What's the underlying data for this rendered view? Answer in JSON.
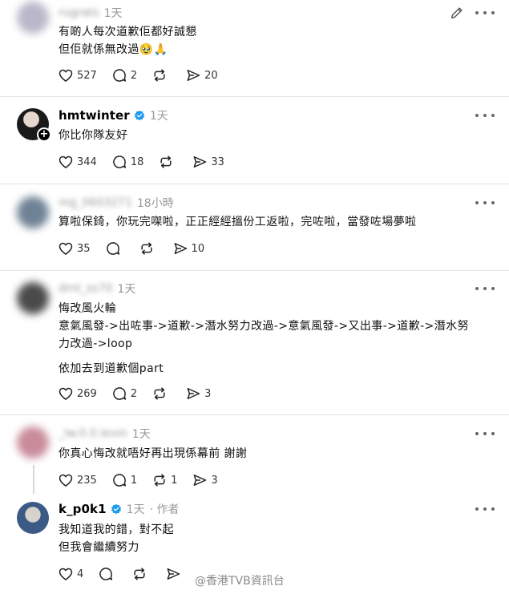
{
  "posts": [
    {
      "username": "",
      "time": "1天",
      "lines": [
        "有啲人每次道歉佢都好誠懇",
        "但佢就係無改過🥹🙏"
      ],
      "likes": "527",
      "replies": "2",
      "reposts": "",
      "shares": "20"
    },
    {
      "username": "hmtwinter",
      "time": "1天",
      "lines": [
        "你比你隊友好"
      ],
      "likes": "344",
      "replies": "18",
      "reposts": "",
      "shares": "33"
    },
    {
      "username": "",
      "time": "18小時",
      "lines": [
        "算啦保錡，你玩完㗎啦，正正經經搵份工返啦，完咗啦，當發咗場夢啦"
      ],
      "likes": "35",
      "replies": "",
      "reposts": "",
      "shares": "10"
    },
    {
      "username": "",
      "time": "1天",
      "lines": [
        "悔改風火輪",
        "意氣風發->出咗事->道歉->潛水努力改過->意氣風發->又出事->道歉->潛水努",
        "力改過->loop",
        "依加去到道歉個part"
      ],
      "likes": "269",
      "replies": "2",
      "reposts": "",
      "shares": "3"
    },
    {
      "username": "",
      "time": "1天",
      "lines": [
        "你真心悔改就唔好再出現係幕前 謝謝"
      ],
      "likes": "235",
      "replies": "1",
      "reposts": "1",
      "shares": "3"
    },
    {
      "username": "k_p0k1",
      "time": "1天",
      "author_tag": "· 作者",
      "lines": [
        "我知道我的錯，對不起",
        "但我會繼續努力"
      ],
      "likes": "4",
      "replies": "",
      "reposts": "",
      "shares": ""
    }
  ],
  "watermark": "@香港TVB資訊台",
  "icons": {
    "like": "heart-icon",
    "reply": "comment-icon",
    "repost": "repost-icon",
    "share": "send-icon",
    "more": "more-icon",
    "edit": "pencil-icon",
    "verified": "verified-badge-icon",
    "follow": "plus-icon"
  },
  "colors": {
    "verified": "#1d9bf0",
    "muted": "#999999",
    "divider": "#e3e3e3"
  }
}
